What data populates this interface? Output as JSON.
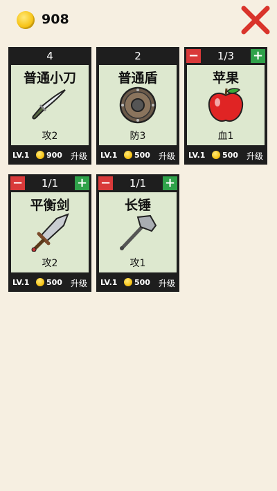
{
  "header": {
    "coins": "908"
  },
  "cards": [
    {
      "count": "4",
      "name": "普通小刀",
      "stat": "攻2",
      "level": "LV.1",
      "price": "900",
      "upgrade": "升级",
      "icon": "knife-icon"
    },
    {
      "count": "2",
      "name": "普通盾",
      "stat": "防3",
      "level": "LV.1",
      "price": "500",
      "upgrade": "升级",
      "icon": "shield-icon"
    },
    {
      "count": "1/3",
      "name": "苹果",
      "stat": "血1",
      "level": "LV.1",
      "price": "500",
      "upgrade": "升级",
      "icon": "apple-icon",
      "minus": "−",
      "plus": "+"
    },
    {
      "count": "1/1",
      "name": "平衡剑",
      "stat": "攻2",
      "level": "LV.1",
      "price": "500",
      "upgrade": "升级",
      "icon": "sword-icon",
      "minus": "−",
      "plus": "+"
    },
    {
      "count": "1/1",
      "name": "长锤",
      "stat": "攻1",
      "level": "LV.1",
      "price": "500",
      "upgrade": "升级",
      "icon": "hammer-icon",
      "minus": "−",
      "plus": "+"
    }
  ],
  "colors": {
    "background": "#f6efe1",
    "card_frame": "#1e1e1e",
    "card_body": "#dde8cf",
    "minus": "#d93a3a",
    "plus": "#2fa24a",
    "close": "#d9342b",
    "coin": "#f7c51a"
  }
}
